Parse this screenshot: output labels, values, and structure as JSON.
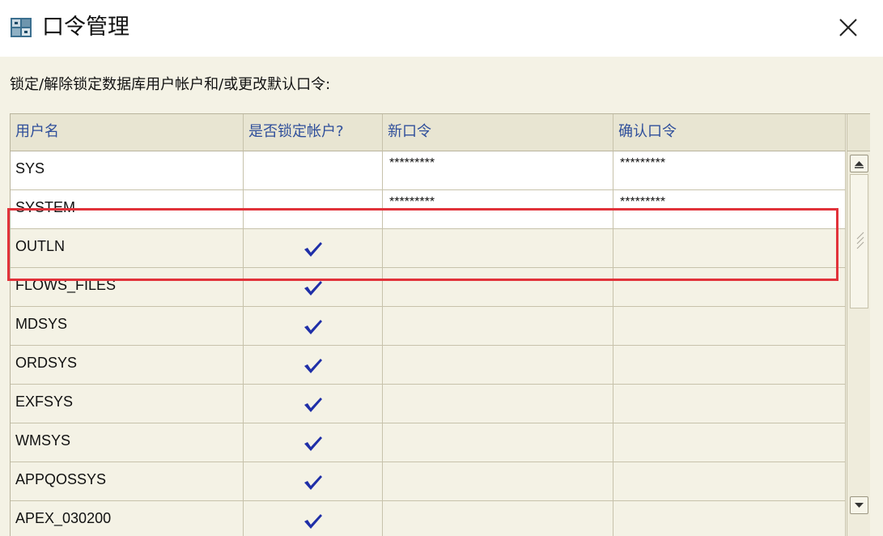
{
  "window": {
    "title": "口令管理",
    "icon": "database-app-icon",
    "close_icon": "close-icon"
  },
  "instruction": "锁定/解除锁定数据库用户帐户和/或更改默认口令:",
  "table": {
    "headers": [
      "用户名",
      "是否锁定帐户?",
      "新口令",
      "确认口令"
    ],
    "rows": [
      {
        "user": "SYS",
        "locked": false,
        "new_password": "*********",
        "confirm_password": "*********"
      },
      {
        "user": "SYSTEM",
        "locked": false,
        "new_password": "*********",
        "confirm_password": "*********"
      },
      {
        "user": "OUTLN",
        "locked": true,
        "new_password": "",
        "confirm_password": ""
      },
      {
        "user": "FLOWS_FILES",
        "locked": true,
        "new_password": "",
        "confirm_password": ""
      },
      {
        "user": "MDSYS",
        "locked": true,
        "new_password": "",
        "confirm_password": ""
      },
      {
        "user": "ORDSYS",
        "locked": true,
        "new_password": "",
        "confirm_password": ""
      },
      {
        "user": "EXFSYS",
        "locked": true,
        "new_password": "",
        "confirm_password": ""
      },
      {
        "user": "WMSYS",
        "locked": true,
        "new_password": "",
        "confirm_password": ""
      },
      {
        "user": "APPQOSSYS",
        "locked": true,
        "new_password": "",
        "confirm_password": ""
      },
      {
        "user": "APEX_030200",
        "locked": true,
        "new_password": "",
        "confirm_password": ""
      }
    ]
  },
  "colors": {
    "panel_bg": "#f4f2e5",
    "header_text": "#2f4f9b",
    "check": "#1f2fa8",
    "highlight_border": "#e1323a"
  }
}
